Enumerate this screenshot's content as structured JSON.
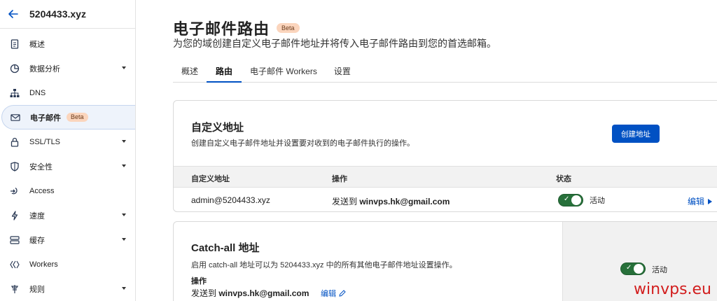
{
  "sidebar": {
    "domain": "5204433.xyz",
    "items": [
      {
        "label": "概述",
        "icon": "document-icon",
        "caret": false
      },
      {
        "label": "数据分析",
        "icon": "chart-pie-icon",
        "caret": true
      },
      {
        "label": "DNS",
        "icon": "network-icon",
        "caret": false
      },
      {
        "label": "电子邮件",
        "icon": "email-icon",
        "caret": false,
        "badge": "Beta",
        "active": true
      },
      {
        "label": "SSL/TLS",
        "icon": "lock-icon",
        "caret": true
      },
      {
        "label": "安全性",
        "icon": "shield-icon",
        "caret": true
      },
      {
        "label": "Access",
        "icon": "access-icon",
        "caret": false
      },
      {
        "label": "速度",
        "icon": "lightning-icon",
        "caret": true
      },
      {
        "label": "缓存",
        "icon": "server-icon",
        "caret": true
      },
      {
        "label": "Workers",
        "icon": "workers-icon",
        "caret": false
      },
      {
        "label": "规则",
        "icon": "rules-icon",
        "caret": true
      }
    ]
  },
  "header": {
    "title": "电子邮件路由",
    "badge": "Beta",
    "subtitle": "为您的域创建自定义电子邮件地址并将传入电子邮件路由到您的首选邮箱。"
  },
  "tabs": [
    "概述",
    "路由",
    "电子邮件 Workers",
    "设置"
  ],
  "custom_address": {
    "title": "自定义地址",
    "description": "创建自定义电子邮件地址并设置要对收到的电子邮件执行的操作。",
    "create_button": "创建地址",
    "columns": [
      "自定义地址",
      "操作",
      "状态"
    ],
    "rows": [
      {
        "address": "admin@5204433.xyz",
        "action_prefix": "发送到 ",
        "action_target": "winvps.hk@gmail.com",
        "status": "活动",
        "edit": "编辑"
      }
    ]
  },
  "catch_all": {
    "title": "Catch-all 地址",
    "description": "启用 catch-all 地址可以为 5204433.xyz 中的所有其他电子邮件地址设置操作。",
    "action_label": "操作",
    "action_prefix": "发送到 ",
    "action_target": "winvps.hk@gmail.com",
    "edit": "编辑",
    "status": "活动"
  },
  "watermark": "winvps.eu",
  "colors": {
    "accent": "#0051c3",
    "toggle_on": "#27703a",
    "beta_bg": "#fbd5bd"
  }
}
